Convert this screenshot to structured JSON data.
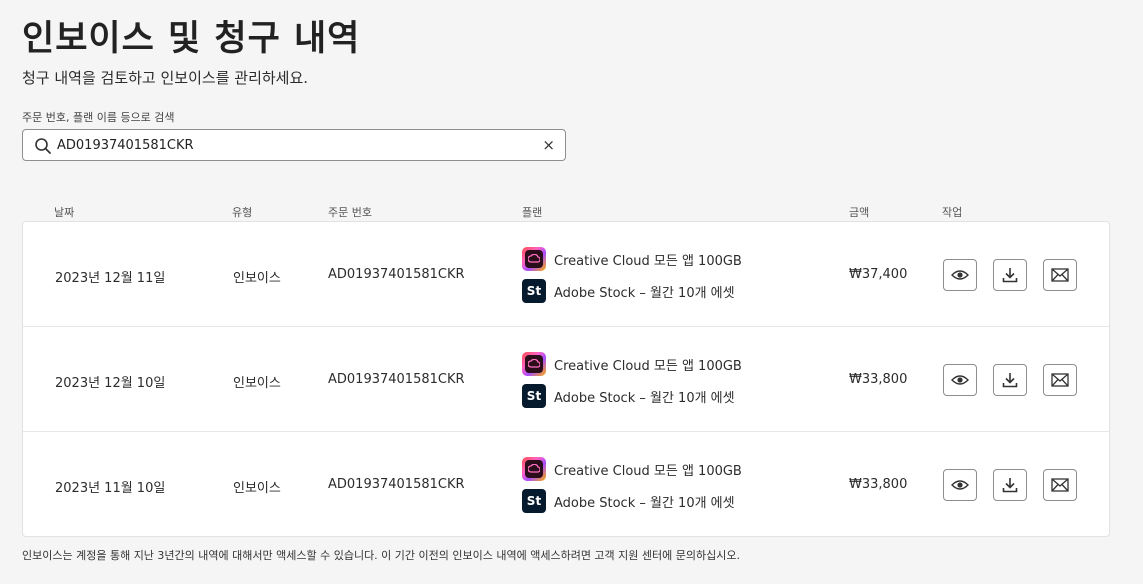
{
  "header": {
    "title": "인보이스 및 청구 내역",
    "subtitle": "청구 내역을 검토하고 인보이스를 관리하세요."
  },
  "search": {
    "label": "주문 번호, 플랜 이름 등으로 검색",
    "value": "AD01937401581CKR",
    "clear_symbol": "×"
  },
  "table": {
    "columns": [
      "날짜",
      "유형",
      "주문 번호",
      "플랜",
      "금액",
      "작업"
    ],
    "rows": [
      {
        "date": "2023년 12월 11일",
        "type": "인보이스",
        "order": "AD01937401581CKR",
        "plans": [
          "Creative Cloud 모든 앱 100GB",
          "Adobe Stock – 월간 10개 에셋"
        ],
        "amount": "₩37,400"
      },
      {
        "date": "2023년 12월 10일",
        "type": "인보이스",
        "order": "AD01937401581CKR",
        "plans": [
          "Creative Cloud 모든 앱 100GB",
          "Adobe Stock – 월간 10개 에셋"
        ],
        "amount": "₩33,800"
      },
      {
        "date": "2023년 11월 10일",
        "type": "인보이스",
        "order": "AD01937401581CKR",
        "plans": [
          "Creative Cloud 모든 앱 100GB",
          "Adobe Stock – 월간 10개 에셋"
        ],
        "amount": "₩33,800"
      }
    ]
  },
  "icons": {
    "stock_label": "St",
    "view": "eye-icon",
    "download": "download-icon",
    "email": "envelope-icon"
  },
  "footer": {
    "note": "인보이스는 계정을 통해 지난 3년간의 내역에 대해서만 액세스할 수 있습니다. 이 기간 이전의 인보이스 내역에 액세스하려면 고객 지원 센터에 문의하십시오."
  }
}
